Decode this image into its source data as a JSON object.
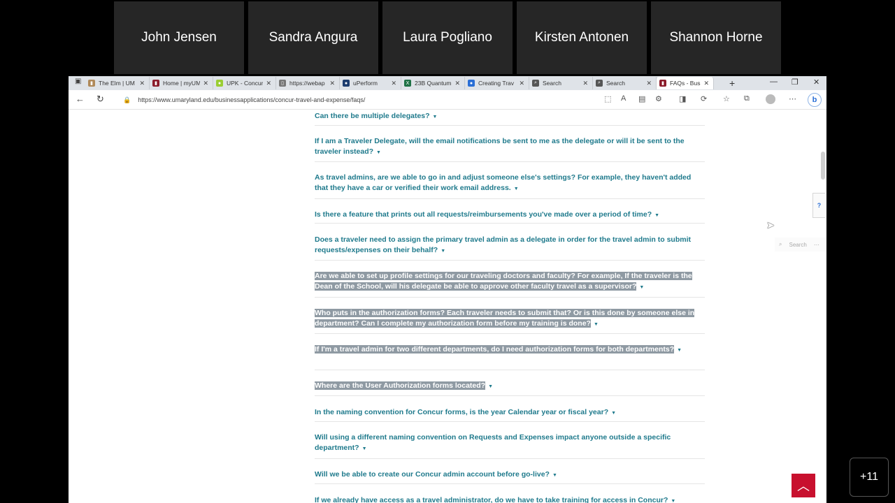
{
  "participants": [
    "John Jensen",
    "Sandra Angura",
    "Laura Pogliano",
    "Kirsten Antonen",
    "Shannon Horne"
  ],
  "tabs": [
    {
      "title": "The Elm | UM",
      "color": "#b08a5a",
      "glyph": "▮"
    },
    {
      "title": "Home | myUM",
      "color": "#8b1d2c",
      "glyph": "▮"
    },
    {
      "title": "UPK - Concur",
      "color": "#9acd32",
      "glyph": "●"
    },
    {
      "title": "https://webap",
      "color": "#777777",
      "glyph": "▯"
    },
    {
      "title": "uPerform",
      "color": "#1d3d6e",
      "glyph": "●"
    },
    {
      "title": "23B Quantum",
      "color": "#1e7145",
      "glyph": "X"
    },
    {
      "title": "Creating Trav",
      "color": "#2a6fd6",
      "glyph": "●"
    },
    {
      "title": "Search",
      "color": "#555555",
      "glyph": "⌕"
    },
    {
      "title": "Search",
      "color": "#555555",
      "glyph": "⌕"
    },
    {
      "title": "FAQs - Busin",
      "color": "#8b1d2c",
      "glyph": "▮"
    }
  ],
  "address": {
    "url": "https://www.umaryland.edu/businessapplications/concur-travel-and-expense/faqs/"
  },
  "faqs": [
    {
      "text": "Can there be multiple delegates?",
      "state": "none"
    },
    {
      "text": "If I am a Traveler Delegate, will the email notifications be sent to me as the delegate or will it be sent to the traveler instead?",
      "state": "none"
    },
    {
      "text": "As travel admins, are we able to go in and adjust someone else's settings? For example, they haven't added that they have a car or verified their work email address.",
      "state": "none"
    },
    {
      "text": "Is there a feature that prints out all requests/reimbursements you've made over a period of time?",
      "state": "none"
    },
    {
      "text": "Does a traveler need to assign the primary travel admin as a delegate in order for the travel admin to submit requests/expenses on their behalf?",
      "state": "none"
    },
    {
      "text": "Are we able to set up profile settings for our traveling doctors and faculty? For example, If the traveler is the Dean of the School, will his delegate be able to approve other faculty travel as a supervisor?",
      "state": "sel"
    },
    {
      "text": "Who puts in the authorization forms? Each traveler needs to submit that? Or is this done by someone else in department? Can I complete my authorization form before my training is done?",
      "state": "sel"
    },
    {
      "text": "If I'm a travel admin for two different departments, do I need authorization forms for both departments?",
      "state": "sel"
    },
    {
      "text": "Where are the User Authorization forms located?",
      "state": "partsel"
    },
    {
      "text": "In the naming convention for Concur forms, is the year Calendar year or fiscal year?",
      "state": "none"
    },
    {
      "text": "Will using a different naming convention on Requests and Expenses impact anyone outside a specific department?",
      "state": "none"
    },
    {
      "text": "Will we be able to create our Concur admin account before go-live?",
      "state": "none"
    },
    {
      "text": "If we already have access as a travel administrator, do we have to take training for access in Concur?",
      "state": "none"
    }
  ],
  "sidebar": {
    "help_label": "?",
    "search_label": "Search",
    "more_label": "⋯"
  },
  "overlay": {
    "more_participants": "+11"
  }
}
